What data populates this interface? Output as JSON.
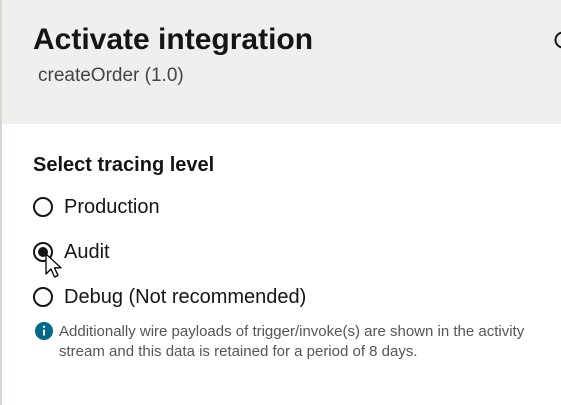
{
  "dialog": {
    "title": "Activate integration",
    "subtitle": "createOrder (1.0)"
  },
  "tracing": {
    "heading": "Select tracing level",
    "options": [
      {
        "label": "Production",
        "selected": false
      },
      {
        "label": "Audit",
        "selected": true
      },
      {
        "label": "Debug (Not recommended)",
        "selected": false
      }
    ],
    "info_icon": "info-icon",
    "info_text": "Additionally wire payloads of trigger/invoke(s) are shown in the activity stream and this data is retained for a period of 8 days."
  },
  "colors": {
    "header_bg": "#f1efed",
    "info_accent": "#00688c",
    "text": "#161513"
  }
}
